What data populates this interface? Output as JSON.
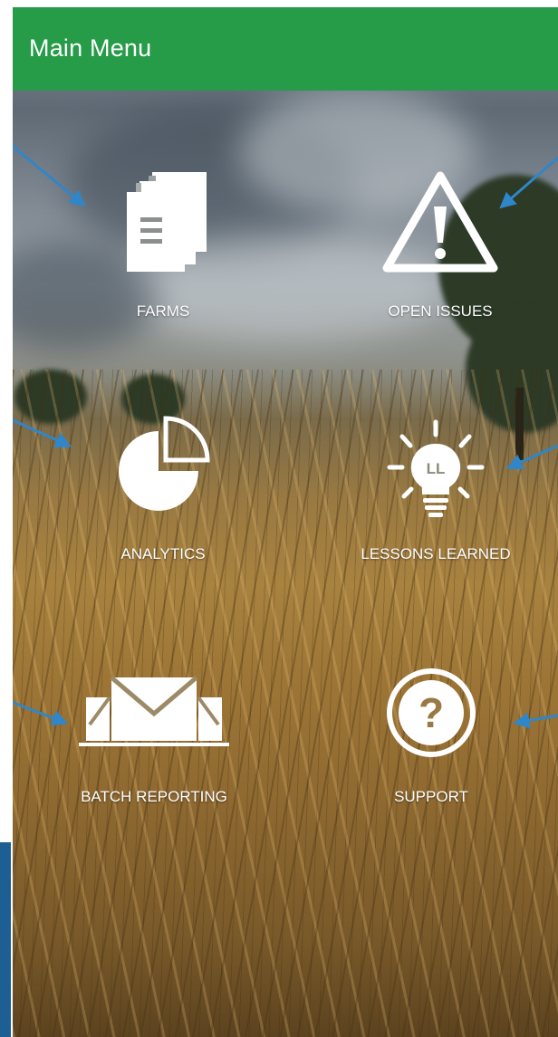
{
  "header": {
    "title": "Main Menu"
  },
  "menu": {
    "items": [
      {
        "label": "FARMS",
        "icon": "document-icon"
      },
      {
        "label": "OPEN ISSUES",
        "icon": "warning-icon"
      },
      {
        "label": "ANALYTICS",
        "icon": "pie-chart-icon"
      },
      {
        "label": "LESSONS LEARNED",
        "icon": "lightbulb-icon",
        "icon_text": "LL"
      },
      {
        "label": "BATCH REPORTING",
        "icon": "envelope-icon"
      },
      {
        "label": "SUPPORT",
        "icon": "help-icon",
        "icon_text": "?"
      }
    ]
  },
  "colors": {
    "header_bg": "#269b48",
    "arrow": "#2f86c9",
    "icon": "#ffffff",
    "edge_strip": "#1d5f93"
  }
}
